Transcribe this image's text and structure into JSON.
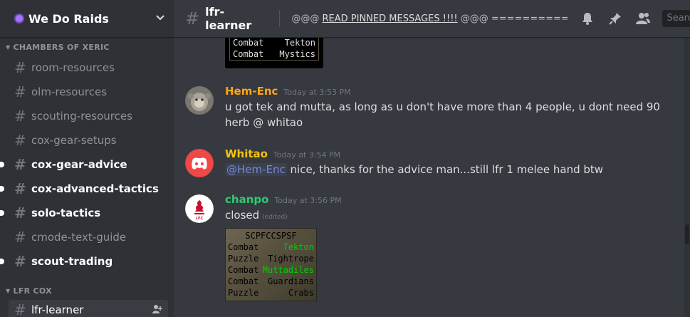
{
  "server": {
    "name": "We Do Raids"
  },
  "sidebar": {
    "category1": "CHAMBERS OF XERIC",
    "channels1": [
      {
        "label": "room-resources",
        "unread": false
      },
      {
        "label": "olm-resources",
        "unread": false
      },
      {
        "label": "scouting-resources",
        "unread": false
      },
      {
        "label": "cox-gear-setups",
        "unread": false
      },
      {
        "label": "cox-gear-advice",
        "unread": true
      },
      {
        "label": "cox-advanced-tactics",
        "unread": true
      },
      {
        "label": "solo-tactics",
        "unread": true
      },
      {
        "label": "cmode-text-guide",
        "unread": false
      },
      {
        "label": "scout-trading",
        "unread": true
      }
    ],
    "category2": "LFR COX",
    "channels2": [
      {
        "label": "lfr-learner",
        "selected": true
      }
    ]
  },
  "header": {
    "channel": "lfr-learner",
    "topic_prefix": "@@@ ",
    "topic_link": "READ PINNED MESSAGES !!!!",
    "topic_suffix": " @@@ ======================",
    "search_placeholder": "Search"
  },
  "messages": {
    "embed_top": {
      "rows": [
        {
          "left": "Combat",
          "right": "Tekton"
        },
        {
          "left": "Combat",
          "right": "Mystics"
        }
      ]
    },
    "m1": {
      "author": "Hem-Enc",
      "author_color": "#faa61a",
      "time": "Today at 3:53 PM",
      "text": "u got tek and mutta, as long as u don't have more than 4 people, u dont need 90 herb @ whitao"
    },
    "m2": {
      "author": "Whitao",
      "author_color": "#f1c40f",
      "time": "Today at 3:54 PM",
      "mention": "@Hem-Enc",
      "text": " nice, thanks for the advice man...still lfr 1 melee hand btw"
    },
    "m3": {
      "author": "chanpo",
      "author_color": "#2ecc71",
      "time": "Today at 3:56 PM",
      "text": "closed",
      "edited": "(edited)",
      "embed": {
        "title": "SCPFCCSPSF",
        "rows": [
          {
            "left": "Combat",
            "right": "Tekton",
            "highlight": true
          },
          {
            "left": "Puzzle",
            "right": "Tightrope",
            "highlight": false
          },
          {
            "left": "Combat",
            "right": "Muttadiles",
            "highlight": true
          },
          {
            "left": "Combat",
            "right": "Guardians",
            "highlight": false
          },
          {
            "left": "Puzzle",
            "right": "Crabs",
            "highlight": false
          }
        ]
      }
    }
  }
}
